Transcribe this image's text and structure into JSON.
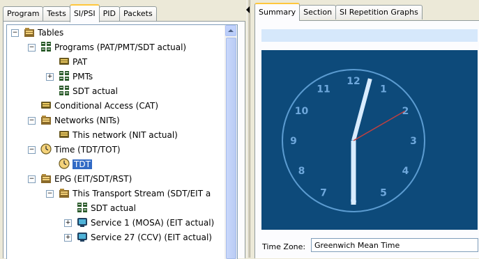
{
  "left_tabs": [
    "Program",
    "Tests",
    "SI/PSI",
    "PID",
    "Packets"
  ],
  "left_active_tab": "SI/PSI",
  "tree": {
    "tables": "Tables",
    "programs": "Programs (PAT/PMT/SDT actual)",
    "pat": "PAT",
    "pmts": "PMTs",
    "sdt_actual": "SDT actual",
    "cat": "Conditional Access (CAT)",
    "networks": "Networks (NITs)",
    "this_network": "This network (NIT actual)",
    "time": "Time (TDT/TOT)",
    "tdt": "TDT",
    "epg": "EPG (EIT/SDT/RST)",
    "this_ts": "This Transport Stream (SDT/EIT a",
    "sdt_actual_2": "SDT actual",
    "service1": "Service 1 (MOSA) (EIT actual)",
    "service27": "Service 27 (CCV) (EIT actual)"
  },
  "right_tabs": [
    "Summary",
    "Section",
    "SI Repetition Graphs"
  ],
  "right_active_tab": "Summary",
  "clock": {
    "numbers": [
      "12",
      "1",
      "2",
      "3",
      "4",
      "5",
      "6",
      "7",
      "8",
      "9",
      "10",
      "11"
    ],
    "hour": 12,
    "minute": 30,
    "second": 10
  },
  "timezone": {
    "label": "Time Zone:",
    "value": "Greenwich Mean Time"
  },
  "colors": {
    "clock_bg": "#0d4a7a",
    "hand": "#d9ecff",
    "second_hand": "#c04040",
    "selection": "#316ac5"
  }
}
